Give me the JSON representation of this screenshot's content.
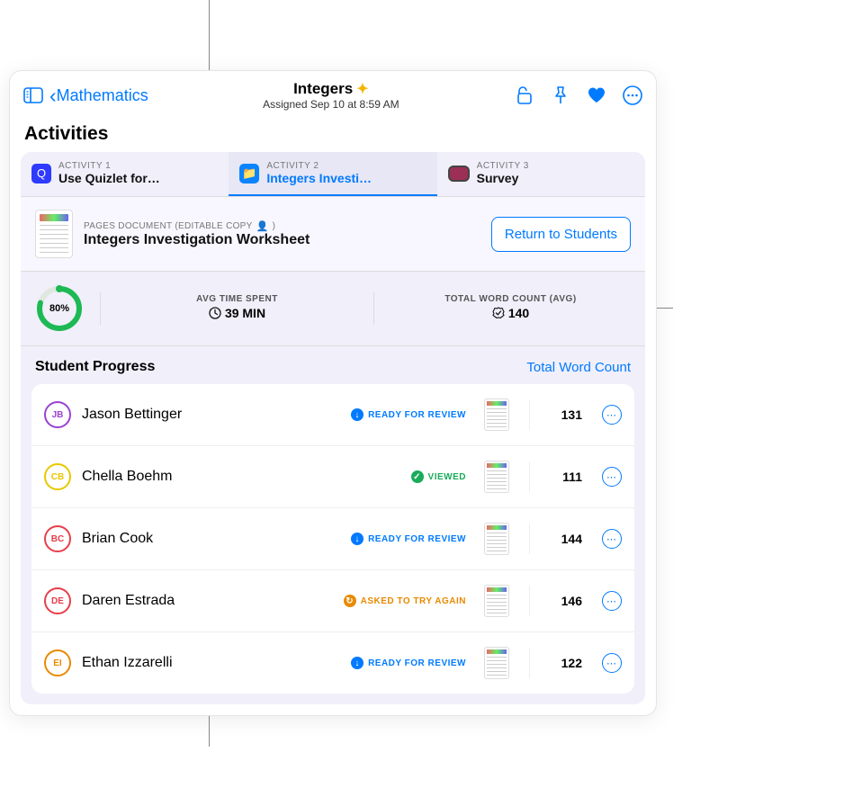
{
  "navbar": {
    "back_label": "Mathematics",
    "title": "Integers",
    "subtitle": "Assigned Sep 10 at 8:59 AM"
  },
  "section_title": "Activities",
  "tabs": [
    {
      "caption": "ACTIVITY 1",
      "label": "Use Quizlet for…",
      "icon": "Q",
      "icon_class": "quizlet",
      "active": false
    },
    {
      "caption": "ACTIVITY 2",
      "label": "Integers Investi…",
      "icon": "📁",
      "icon_class": "folder",
      "active": true
    },
    {
      "caption": "ACTIVITY 3",
      "label": "Survey",
      "icon": "",
      "icon_class": "survey",
      "active": false
    }
  ],
  "document": {
    "caption": "PAGES DOCUMENT (EDITABLE COPY",
    "caption_suffix": ")",
    "title": "Integers Investigation Worksheet",
    "return_button": "Return to Students"
  },
  "stats": {
    "completion_percent": "80%",
    "avg_time_caption": "AVG TIME SPENT",
    "avg_time_value": "39 MIN",
    "word_count_caption": "TOTAL WORD COUNT (AVG)",
    "word_count_value": "140"
  },
  "progress": {
    "title": "Student Progress",
    "link": "Total Word Count"
  },
  "students": [
    {
      "initials": "JB",
      "color": "#9b42d1",
      "name": "Jason Bettinger",
      "status": "READY FOR REVIEW",
      "status_class": "review",
      "status_icon": "↓",
      "count": "131"
    },
    {
      "initials": "CB",
      "color": "#e8c800",
      "name": "Chella Boehm",
      "status": "VIEWED",
      "status_class": "viewed",
      "status_icon": "✓",
      "count": "111"
    },
    {
      "initials": "BC",
      "color": "#e83e4b",
      "name": "Brian Cook",
      "status": "READY FOR REVIEW",
      "status_class": "review",
      "status_icon": "↓",
      "count": "144"
    },
    {
      "initials": "DE",
      "color": "#e83e4b",
      "name": "Daren Estrada",
      "status": "ASKED TO TRY AGAIN",
      "status_class": "tryagain",
      "status_icon": "↻",
      "count": "146"
    },
    {
      "initials": "EI",
      "color": "#e88a00",
      "name": "Ethan Izzarelli",
      "status": "READY FOR REVIEW",
      "status_class": "review",
      "status_icon": "↓",
      "count": "122"
    }
  ]
}
